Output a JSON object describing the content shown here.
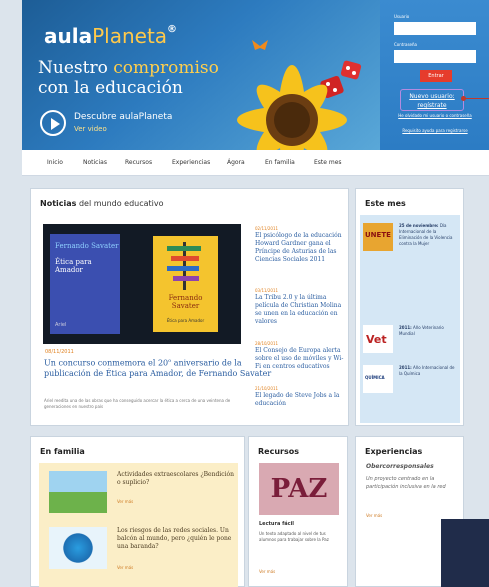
{
  "header": {
    "logo_prefix": "aula",
    "logo_accent": "Planeta",
    "logo_reg": "®",
    "hero_line1": "Nuestro",
    "hero_highlight": "compromiso",
    "hero_line2": "con la educación",
    "video_title": "Descubre aulaPlaneta",
    "video_sub": "Ver video"
  },
  "login": {
    "user_label": "Usuario",
    "password_label": "Contraseña",
    "enter_label": "Entrar",
    "register_line1": "Nuevo usuario:",
    "register_line2": "regístrate",
    "forgot": "He olvidado mi usuario o contraseña",
    "help": "Requisito ayuda para registrarse"
  },
  "nav": {
    "items": [
      "Inicio",
      "Noticias",
      "Recursos",
      "Experiencias",
      "Ágora",
      "En familia",
      "Este mes"
    ]
  },
  "news": {
    "title_bold": "Noticias",
    "title_rest": "del mundo educativo",
    "book1": {
      "author": "Fernando Savater",
      "title": "Ética para Amador",
      "publisher": "Ariel"
    },
    "book2": {
      "author": "Fernando Savater",
      "subtitle": "Ética para Amador"
    },
    "main": {
      "date": "08/11/2011",
      "headline_a": "Un concurso conmemora el 20",
      "headline_sup": "o",
      "headline_b": "aniversario de la publicación de Ética para Amador, de Fernando Savater",
      "summary": "Ariel reedita una de las obras que ha conseguido acercar la ética a cerca de una veintena de generaciones en nuestro país"
    },
    "side": [
      {
        "date": "02/11/2011",
        "headline": "El psicólogo de la educación Howard Gardner gana el Príncipe de Asturias de las Ciencias Sociales 2011"
      },
      {
        "date": "03/11/2011",
        "headline": "La Tribu 2.0 y la última película de Christian Molina se unen en la educación en valores"
      },
      {
        "date": "28/10/2011",
        "headline": "El Consejo de Europa alerta sobre el uso de móviles y Wi-Fi en centros educativos"
      },
      {
        "date": "21/10/2011",
        "headline": "El legado de Steve Jobs a la educación"
      }
    ]
  },
  "month": {
    "title": "Este mes",
    "items": [
      {
        "date": "25 de noviembre:",
        "text": "Día Internacional de la Eliminación de la Violencia contra la Mujer",
        "badge": "UNETE"
      },
      {
        "date": "2011:",
        "text": "Año Veterinario Mundial",
        "badge": "Vet"
      },
      {
        "date": "2011:",
        "text": "Año Internacional de la Química",
        "badge": "QUÍMICA"
      }
    ]
  },
  "family": {
    "title": "En familia",
    "items": [
      {
        "title": "Actividades extraescolares ¿Bendición o suplicio?",
        "more": "Ver más"
      },
      {
        "title": "Los riesgos de las redes sociales. Un balcón al mundo, pero ¿quién le pone una baranda?",
        "more": "Ver más"
      }
    ]
  },
  "resources": {
    "title": "Recursos",
    "image_text": "PAZ",
    "subtitle": "Lectura fácil",
    "text": "Un texto adaptado al nivel de tus alumnos para trabajar sobre la Paz",
    "more": "Ver más"
  },
  "experiences": {
    "title": "Experiencias",
    "subtitle": "Obercorresponsales",
    "text": "Un proyecto centrado en la participación inclusiva en la red",
    "more": "Ver más"
  },
  "colors": {
    "header": "#2d7bbf",
    "accent": "#ffc94a",
    "enter": "#e63c2c",
    "link": "#2a5da0",
    "date": "#e0801e"
  }
}
